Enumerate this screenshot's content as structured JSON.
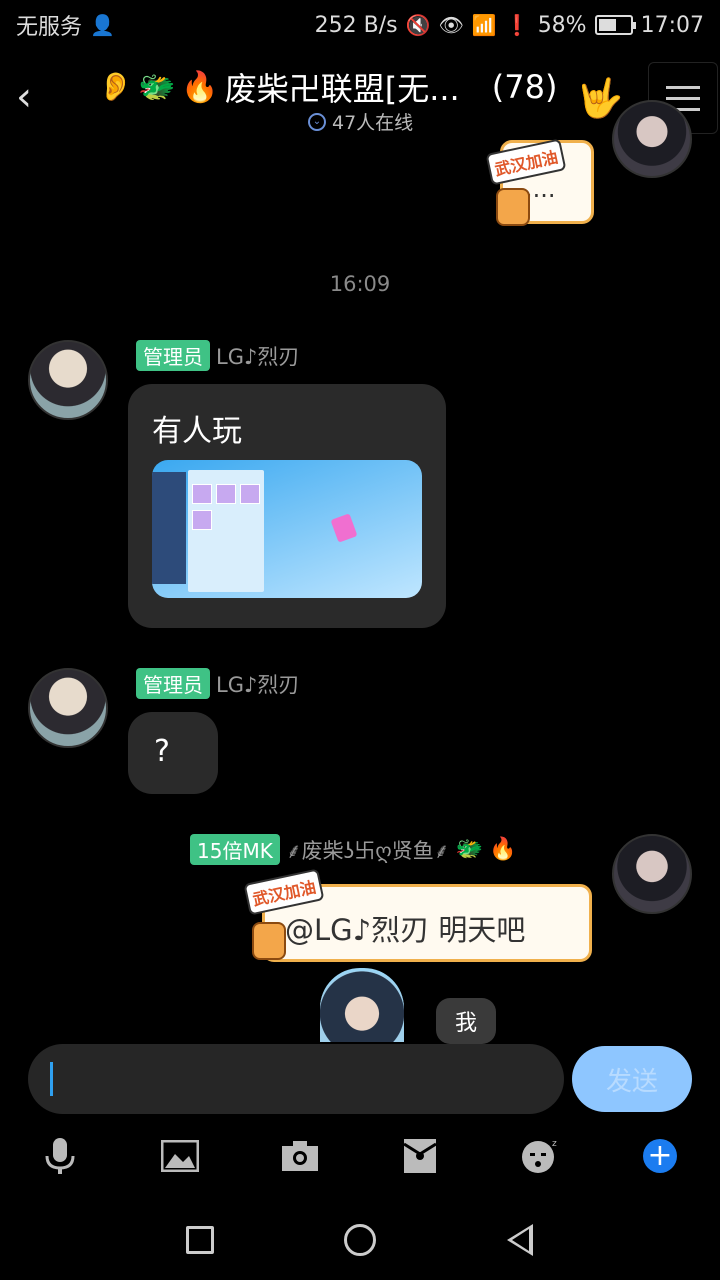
{
  "status_bar": {
    "carrier": "无服务",
    "network_speed": "252 B/s",
    "battery_percent": "58%",
    "battery_level": 0.58,
    "time": "17:07"
  },
  "header": {
    "back_icon": "chevron-left-icon",
    "ear_icon": "ear-icon",
    "title_emojis": [
      "🐲",
      "🔥"
    ],
    "title": "废柴卍联盟[无...",
    "member_count": "(78)",
    "online_text": "47人在线",
    "hand_icon": "rock-hand-icon",
    "menu_icon": "menu-icon"
  },
  "chat": {
    "top_partial_message": "....",
    "sticker_caption": "武汉加油",
    "timestamp": "16:09",
    "messages": [
      {
        "badge": "管理员",
        "sender": "LG♪烈刃",
        "text": "有人玩",
        "has_image": true
      },
      {
        "badge": "管理员",
        "sender": "LG♪烈刃",
        "text": "?"
      },
      {
        "badge": "15倍MK",
        "sender": "⸙废柴ʖ卐ღ贤鱼⸙",
        "sender_emojis": [
          "🐲",
          "🔥"
        ],
        "text": "@LG♪烈刃 明天吧"
      }
    ],
    "floating_bubble": "我"
  },
  "input": {
    "placeholder": "",
    "send_label": "发送"
  },
  "toolbar": {
    "icons": [
      "microphone-icon",
      "image-icon",
      "camera-icon",
      "red-packet-icon",
      "emoji-icon",
      "plus-icon"
    ]
  },
  "nav": {
    "icons": [
      "recents-icon",
      "home-icon",
      "back-icon"
    ]
  }
}
